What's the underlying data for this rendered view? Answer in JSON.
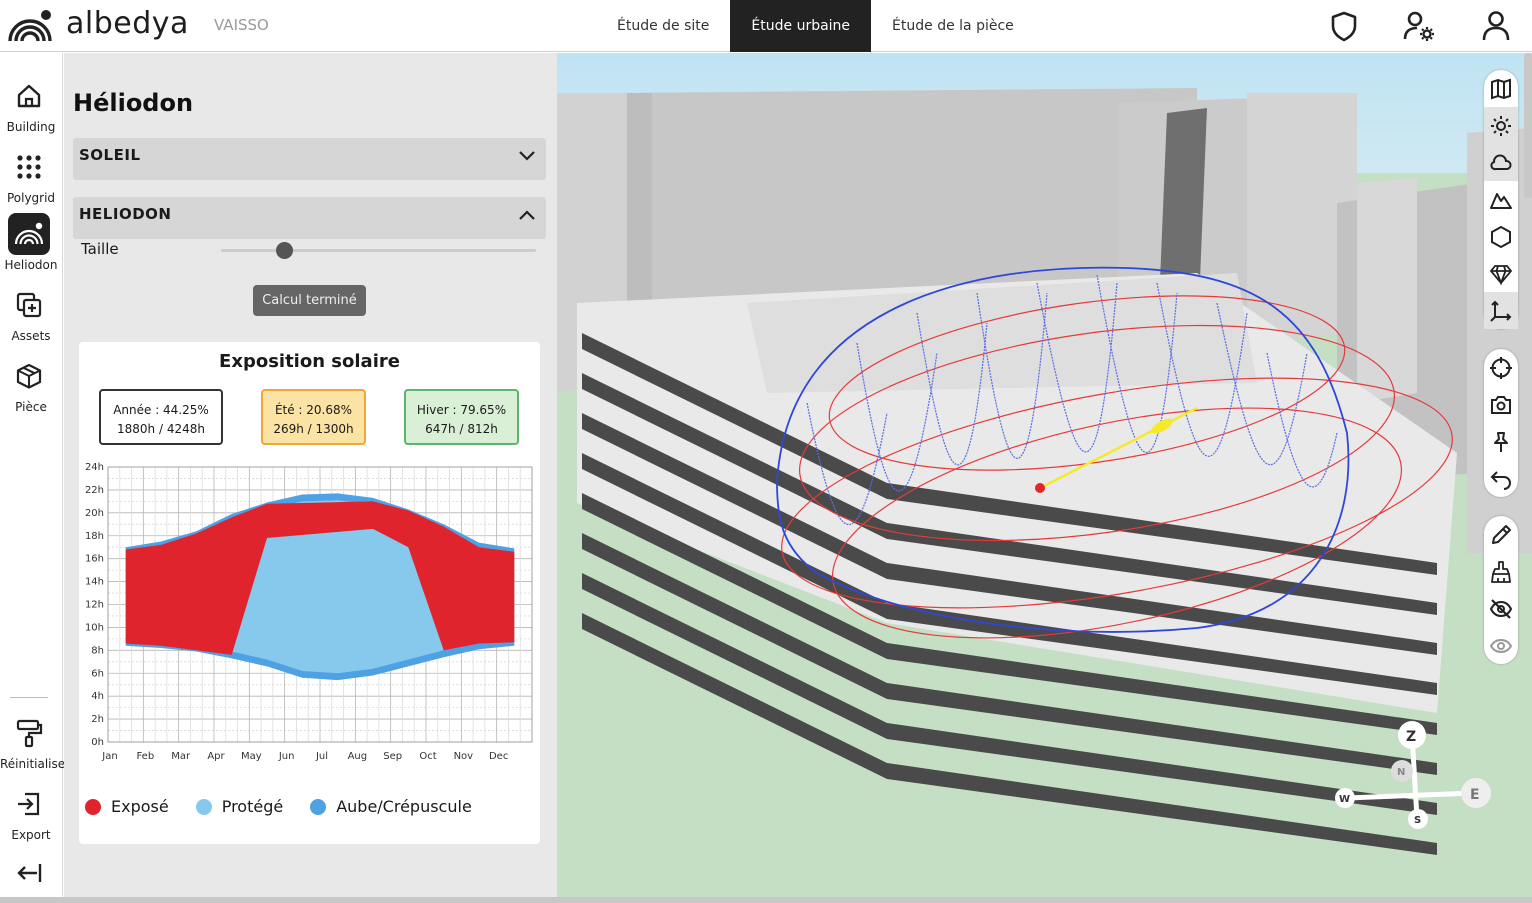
{
  "header": {
    "brand": "albedya",
    "project": "VAISSO",
    "tabs": [
      {
        "label": "Étude de site",
        "active": false
      },
      {
        "label": "Étude urbaine",
        "active": true
      },
      {
        "label": "Étude de la pièce",
        "active": false
      }
    ],
    "icons": [
      "shield-icon",
      "user-settings-icon",
      "user-icon"
    ]
  },
  "rail": {
    "items": [
      {
        "label": "Building",
        "icon": "home-icon"
      },
      {
        "label": "Polygrid",
        "icon": "grid-dots-icon"
      },
      {
        "label": "Heliodon",
        "icon": "heliodon-icon",
        "active": true
      },
      {
        "label": "Assets",
        "icon": "add-asset-icon"
      },
      {
        "label": "Pièce",
        "icon": "cube-icon"
      }
    ],
    "bottom": [
      {
        "label": "Réinitialiser",
        "icon": "paint-roller-icon"
      },
      {
        "label": "Export",
        "icon": "export-icon"
      }
    ],
    "collapse_icon": "collapse-left-icon"
  },
  "panel": {
    "title": "Héliodon",
    "soleil": {
      "label": "SOLEIL",
      "expanded": false
    },
    "heliodon": {
      "label": "HELIODON",
      "expanded": true,
      "size_label": "Taille",
      "size_value": 0.2,
      "calc_button": "Calcul terminé"
    },
    "card": {
      "title": "Exposition solaire",
      "year": {
        "line1": "Année : 44.25%",
        "line2": "1880h / 4248h"
      },
      "summer": {
        "line1": "Été : 20.68%",
        "line2": "269h / 1300h"
      },
      "winter": {
        "line1": "Hiver : 79.65%",
        "line2": "647h / 812h"
      },
      "legend": [
        {
          "label": "Exposé",
          "color": "#e0242e"
        },
        {
          "label": "Protégé",
          "color": "#86c9ec"
        },
        {
          "label": "Aube/Crépuscule",
          "color": "#4ea1e3"
        }
      ]
    }
  },
  "chart_data": {
    "type": "area",
    "x": [
      "Jan",
      "Feb",
      "Mar",
      "Apr",
      "May",
      "Jun",
      "Jul",
      "Aug",
      "Sep",
      "Oct",
      "Nov",
      "Dec"
    ],
    "y_ticks": [
      "0h",
      "2h",
      "4h",
      "6h",
      "8h",
      "10h",
      "12h",
      "14h",
      "16h",
      "18h",
      "20h",
      "22h",
      "24h"
    ],
    "ylim": [
      0,
      24
    ],
    "grid": true,
    "legend": "bottom",
    "series": [
      {
        "name": "Aube/Crépuscule",
        "color": "#4ea1e3",
        "sunrise": [
          8.4,
          8.2,
          7.9,
          7.3,
          6.6,
          5.6,
          5.4,
          5.8,
          6.6,
          7.4,
          8.1,
          8.4
        ],
        "sunset": [
          17.0,
          17.5,
          18.4,
          19.9,
          20.9,
          21.6,
          21.7,
          21.3,
          20.3,
          19.0,
          17.4,
          16.9
        ]
      },
      {
        "name": "Protégé",
        "color": "#86c9ec",
        "start": [
          null,
          null,
          10.0,
          8.8,
          7.4,
          6.0,
          6.0,
          6.4,
          7.6,
          8.8,
          null,
          null
        ],
        "end": [
          null,
          null,
          16.0,
          16.4,
          19.8,
          21.1,
          21.2,
          19.2,
          17.4,
          16.0,
          null,
          null
        ]
      },
      {
        "name": "Exposé",
        "color": "#e0242e",
        "start": [
          8.6,
          8.4,
          8.0,
          7.6,
          17.8,
          null,
          null,
          18.6,
          17.0,
          8.0,
          8.6,
          8.7
        ],
        "end": [
          16.8,
          17.2,
          18.2,
          19.6,
          20.8,
          null,
          null,
          21.0,
          20.2,
          18.8,
          17.0,
          16.6
        ]
      }
    ]
  }
}
